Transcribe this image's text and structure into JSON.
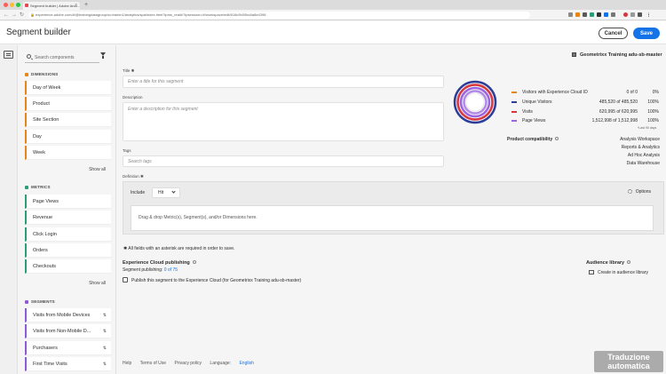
{
  "browser": {
    "tab_title": "Segment builder | Adobe Anal...",
    "tab_close": "×",
    "newtab": "+",
    "nav_back": "←",
    "nav_forward": "→",
    "nav_reload": "↻",
    "url": "experience.adobe.com/#/@trainingdatagroup/so:trainin1/analytics/spa/index.html?lpms_real#/?lpsession=/#/workspace/edit/618c9b00bd4a8e4398",
    "url_lock": "🔒"
  },
  "app": {
    "title": "Segment builder",
    "cancel_label": "Cancel",
    "save_label": "Save"
  },
  "components": {
    "search_placeholder": "Search components",
    "dimensions": {
      "header": "DIMENSIONS",
      "items": [
        "Day of Week",
        "Product",
        "Site Section",
        "Day",
        "Week"
      ],
      "show_all": "Show all"
    },
    "metrics": {
      "header": "METRICS",
      "items": [
        "Page Views",
        "Revenue",
        "Click Login",
        "Orders",
        "Checkouts"
      ],
      "show_all": "Show all"
    },
    "segments": {
      "header": "SEGMENTS",
      "items": [
        "Visits from Mobile Devices",
        "Visits from Non-Mobile D...",
        "Purchasers",
        "First Time Visits"
      ],
      "item_icon": "⇅"
    }
  },
  "form": {
    "title_label": "Title ✱",
    "title_placeholder": "Enter a title for this segment",
    "description_label": "Description",
    "description_placeholder": "Enter a description for this segment",
    "tags_label": "Tags",
    "tags_placeholder": "Search tags",
    "definition_label": "Definition ✱",
    "include_label": "Include",
    "include_value": "Hit",
    "options_label": "Options",
    "dropzone": "Drag & drop Metric(s), Segment(s), and/or Dimensions here.",
    "required_note": "✱ All fields with an asterisk are required in order to save."
  },
  "publishing": {
    "title": "Experience Cloud publishing",
    "count_prefix": "Segment publishing: ",
    "count_value": "0 of 75",
    "checkbox_label": "Publish this segment to the Experience Cloud (for Geometrixx Training adu-sb-master)"
  },
  "audience": {
    "title": "Audience library",
    "link": "Create in audience library"
  },
  "summary": {
    "report_suite": "Geometrixx Training adu-sb-master",
    "legend": [
      {
        "name": "Visitors with Experience Cloud ID",
        "count": "0 of 0",
        "pct": "0%",
        "color": "#e68619"
      },
      {
        "name": "Unique Visitors",
        "count": "485,520 of 485,520",
        "pct": "100%",
        "color": "#2c3e9a"
      },
      {
        "name": "Visits",
        "count": "620,995 of 620,995",
        "pct": "100%",
        "color": "#d7373f"
      },
      {
        "name": "Page Views",
        "count": "1,512,998 of 1,512,998",
        "pct": "100%",
        "color": "#9d64e1"
      }
    ],
    "last_days": "*Last 90 days",
    "product_compat_title": "Product compatibility",
    "product_compat": [
      "Analysis Workspace",
      "Reports & Analytics",
      "Ad Hoc Analysis",
      "Data Warehouse"
    ]
  },
  "footer": {
    "help": "Help",
    "terms": "Terms of Use",
    "privacy": "Privacy policy",
    "language_label": "Language:",
    "language": "English"
  },
  "watermark": {
    "line1": "Traduzione",
    "line2": "automatica"
  }
}
